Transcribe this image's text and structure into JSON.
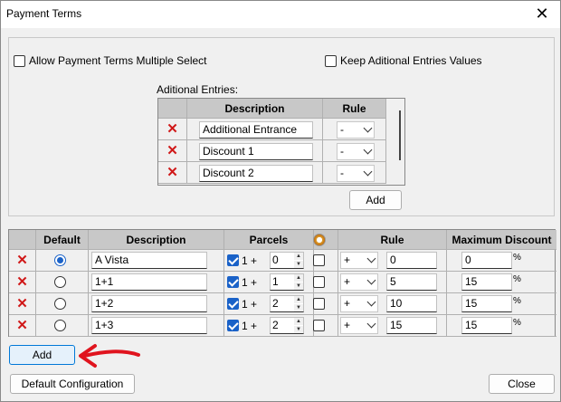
{
  "window": {
    "title": "Payment Terms",
    "close_glyph": "✕"
  },
  "options": {
    "allow_multi_select": {
      "label": "Allow Payment Terms Multiple Select",
      "checked": false
    },
    "keep_additional_values": {
      "label": "Keep Aditional Entries Values",
      "checked": false
    }
  },
  "additional_entries": {
    "label": "Aditional Entries:",
    "headers": {
      "description": "Description",
      "rule": "Rule"
    },
    "rows": [
      {
        "description": "Additional Entrance",
        "rule": "-"
      },
      {
        "description": "Discount 1",
        "rule": "-"
      },
      {
        "description": "Discount 2",
        "rule": "-"
      }
    ],
    "add_label": "Add"
  },
  "terms": {
    "headers": {
      "default": "Default",
      "description": "Description",
      "parcels": "Parcels",
      "rule": "Rule",
      "max_discount": "Maximum Discount"
    },
    "rows": [
      {
        "default": true,
        "description": "A Vista",
        "parcels_checked": true,
        "parcels_prefix": "1 +",
        "parcels_value": "0",
        "extra_checked": false,
        "rule": "+",
        "rule_value": "0",
        "max_discount": "0",
        "unit": "%"
      },
      {
        "default": false,
        "description": "1+1",
        "parcels_checked": true,
        "parcels_prefix": "1 +",
        "parcels_value": "1",
        "extra_checked": false,
        "rule": "+",
        "rule_value": "5",
        "max_discount": "15",
        "unit": "%"
      },
      {
        "default": false,
        "description": "1+2",
        "parcels_checked": true,
        "parcels_prefix": "1 +",
        "parcels_value": "2",
        "extra_checked": false,
        "rule": "+",
        "rule_value": "10",
        "max_discount": "15",
        "unit": "%"
      },
      {
        "default": false,
        "description": "1+3",
        "parcels_checked": true,
        "parcels_prefix": "1 +",
        "parcels_value": "2",
        "extra_checked": false,
        "rule": "+",
        "rule_value": "15",
        "max_discount": "15",
        "unit": "%"
      }
    ],
    "add_label": "Add"
  },
  "footer": {
    "default_config_label": "Default Configuration",
    "close_label": "Close"
  },
  "colors": {
    "accent": "#1a62c8",
    "delete": "#d01818",
    "annotation_arrow": "#e0141e"
  }
}
